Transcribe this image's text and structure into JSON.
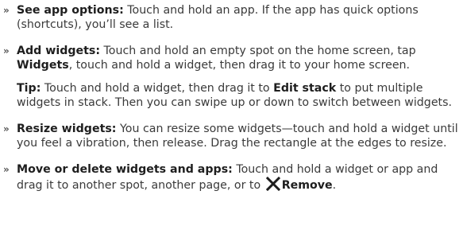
{
  "items": [
    {
      "bullet": "»",
      "title": "See app options:",
      "text": " Touch and hold an app. If the app has quick options (shortcuts), you’ll see a list."
    },
    {
      "bullet": "»",
      "title": "Add widgets:",
      "text_a": " Touch and hold an empty spot on the home screen, tap ",
      "bold_mid": "Widgets",
      "text_b": ", touch and hold a widget, then drag it to your home screen."
    },
    {
      "tip_title": "Tip:",
      "tip_text_a": " Touch and hold a widget, then drag it to ",
      "tip_bold": "Edit stack",
      "tip_text_b": " to put multiple widgets in stack. Then you can swipe up or down to switch between widgets."
    },
    {
      "bullet": "»",
      "title": "Resize widgets:",
      "text": " You can resize some widgets—touch and hold a widget until you feel a vibration, then release. Drag the rectangle at the edges to resize."
    },
    {
      "bullet": "»",
      "title": "Move or delete widgets and apps:",
      "text_a": " Touch and hold a widget or app and drag it to another spot, another page, or to ",
      "icon": "close-x-icon",
      "bold_end": "Remove",
      "end": "."
    }
  ]
}
